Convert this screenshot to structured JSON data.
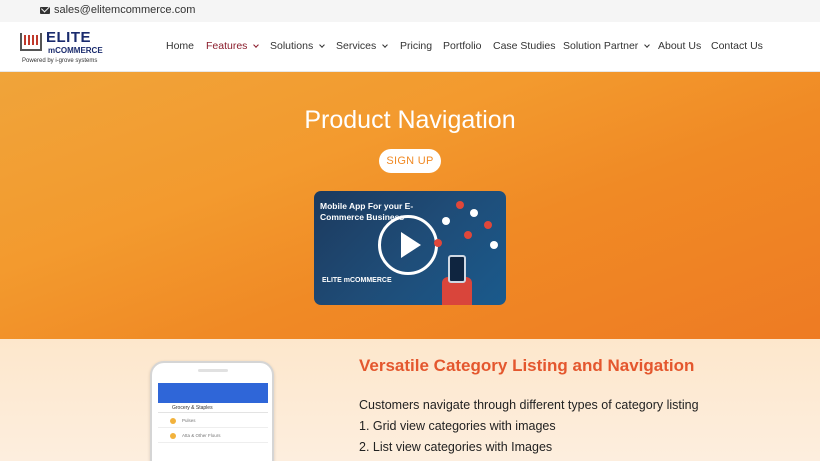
{
  "topbar": {
    "email": "sales@elitemcommerce.com"
  },
  "logo": {
    "name": "ELITE",
    "sub": "mCOMMERCE",
    "powered": "Powered by i-grove systems"
  },
  "nav": {
    "items": [
      {
        "label": "Home",
        "dropdown": false,
        "active": false
      },
      {
        "label": "Features",
        "dropdown": true,
        "active": true
      },
      {
        "label": "Solutions",
        "dropdown": true,
        "active": false
      },
      {
        "label": "Services",
        "dropdown": true,
        "active": false
      },
      {
        "label": "Pricing",
        "dropdown": false,
        "active": false
      },
      {
        "label": "Portfolio",
        "dropdown": false,
        "active": false
      },
      {
        "label": "Case Studies",
        "dropdown": false,
        "active": false
      },
      {
        "label": "Solution Partner",
        "dropdown": true,
        "active": false
      },
      {
        "label": "About Us",
        "dropdown": false,
        "active": false
      },
      {
        "label": "Contact Us",
        "dropdown": false,
        "active": false
      }
    ]
  },
  "hero": {
    "title": "Product Navigation",
    "signup_label": "SIGN UP",
    "video": {
      "title": "Mobile App For your E-Commerce Business",
      "logo_text": "ELITE mCOMMERCE"
    }
  },
  "section": {
    "title": "Versatile Category Listing and Navigation",
    "lines": [
      "Customers navigate through different types of category listing",
      "1. Grid view categories with images",
      "2. List view categories with Images"
    ],
    "phone": {
      "header": "Grocery & Staples",
      "rows": [
        "Pulses",
        "Atta & Other Flours"
      ]
    }
  },
  "colors": {
    "accent": "#e4572e",
    "nav_active": "#8b1d2c",
    "hero": "#f08a25",
    "phone_bar": "#2f66d8"
  }
}
